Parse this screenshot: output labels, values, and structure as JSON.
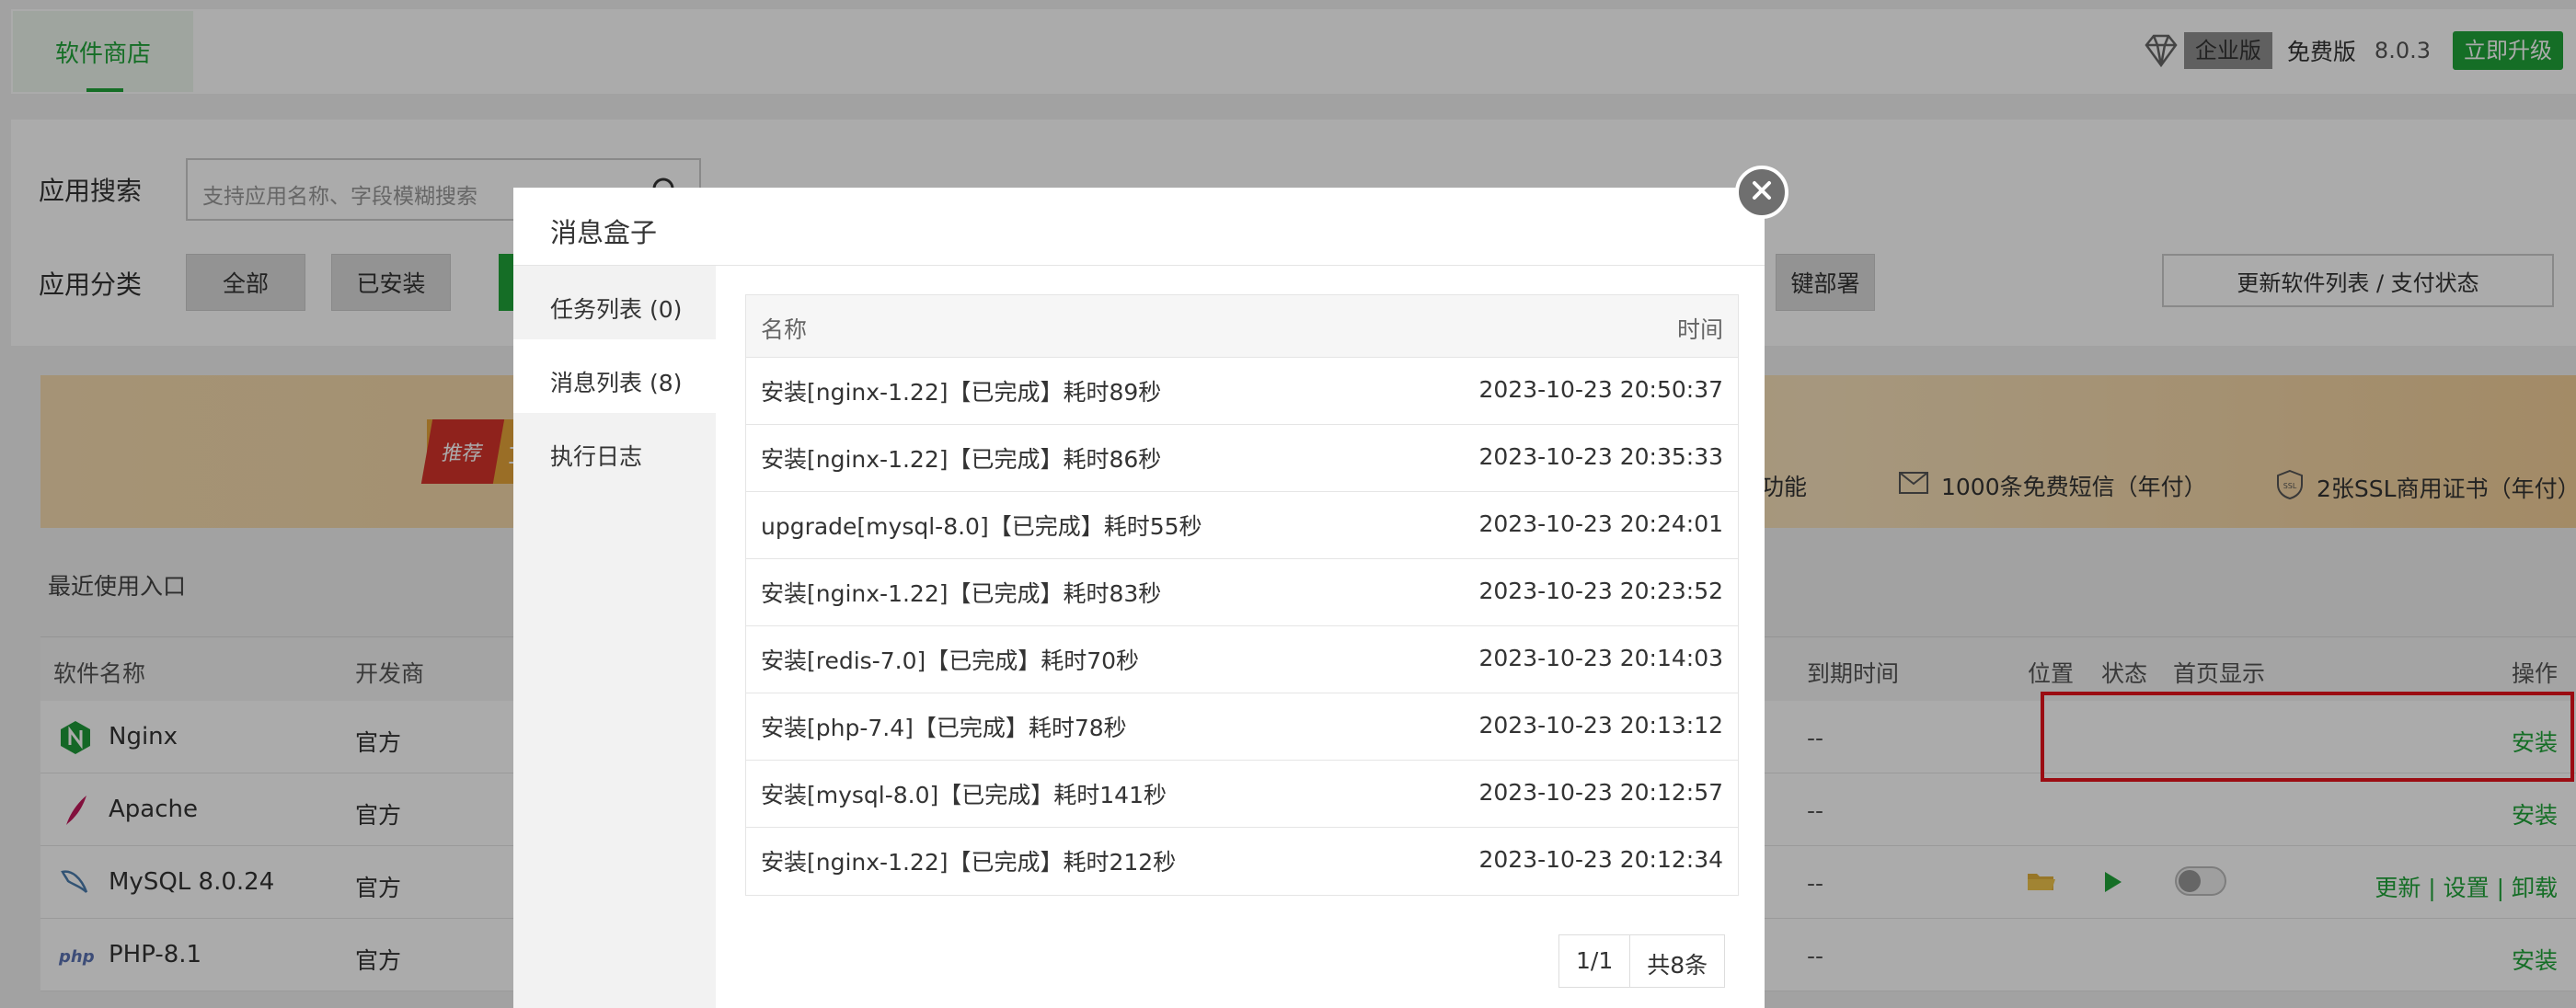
{
  "topbar": {
    "tab": "软件商店",
    "edition_badge": "企业版",
    "free_label": "免费版",
    "version": "8.0.3",
    "upgrade_label": "立即升级"
  },
  "filters": {
    "search_label": "应用搜索",
    "search_placeholder": "支持应用名称、字段模糊搜索",
    "category_label": "应用分类",
    "categories": [
      "全部",
      "已安装"
    ],
    "partial_category": "键部署",
    "refresh_label": "更新软件列表 / 支付状态"
  },
  "banner": {
    "tag": "推荐",
    "tag_text": "立",
    "features": [
      "功能",
      "1000条免费短信（年付）",
      "2张SSL商用证书（年付）"
    ]
  },
  "recent_label": "最近使用入口",
  "software_table": {
    "headers": {
      "name": "软件名称",
      "developer": "开发商",
      "expiry": "到期时间",
      "location": "位置",
      "status": "状态",
      "homepage": "首页显示",
      "actions": "操作"
    },
    "rows": [
      {
        "name": "Nginx",
        "developer": "官方",
        "expiry": "--",
        "actions": "安装"
      },
      {
        "name": "Apache",
        "developer": "官方",
        "expiry": "--",
        "actions": "安装"
      },
      {
        "name": "MySQL 8.0.24",
        "developer": "官方",
        "expiry": "--",
        "actions": "更新 | 设置 | 卸载"
      },
      {
        "name": "PHP-8.1",
        "developer": "官方",
        "expiry": "--",
        "actions": "安装"
      }
    ]
  },
  "modal": {
    "title": "消息盒子",
    "tabs": [
      "任务列表 (0)",
      "消息列表 (8)",
      "执行日志"
    ],
    "active_tab": 1,
    "table": {
      "col_name": "名称",
      "col_time": "时间",
      "rows": [
        {
          "name": "安装[nginx-1.22]【已完成】耗时89秒",
          "time": "2023-10-23 20:50:37"
        },
        {
          "name": "安装[nginx-1.22]【已完成】耗时86秒",
          "time": "2023-10-23 20:35:33"
        },
        {
          "name": "upgrade[mysql-8.0]【已完成】耗时55秒",
          "time": "2023-10-23 20:24:01"
        },
        {
          "name": "安装[nginx-1.22]【已完成】耗时83秒",
          "time": "2023-10-23 20:23:52"
        },
        {
          "name": "安装[redis-7.0]【已完成】耗时70秒",
          "time": "2023-10-23 20:14:03"
        },
        {
          "name": "安装[php-7.4]【已完成】耗时78秒",
          "time": "2023-10-23 20:13:12"
        },
        {
          "name": "安装[mysql-8.0]【已完成】耗时141秒",
          "time": "2023-10-23 20:12:57"
        },
        {
          "name": "安装[nginx-1.22]【已完成】耗时212秒",
          "time": "2023-10-23 20:12:34"
        }
      ]
    },
    "pager": {
      "page": "1/1",
      "total": "共8条"
    }
  },
  "colors": {
    "accent": "#20a53a",
    "highlight": "#e8131c"
  }
}
